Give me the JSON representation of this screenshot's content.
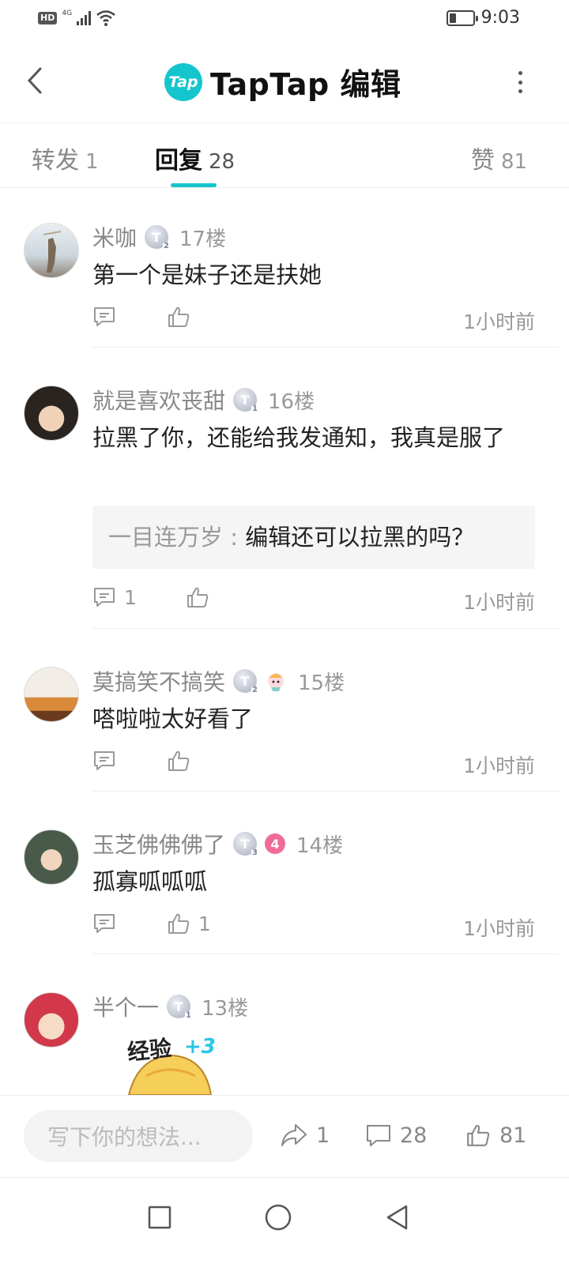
{
  "status_bar": {
    "hd": "HD",
    "network": "4G",
    "time": "9:03",
    "icons": [
      "hd-icon",
      "signal-icon",
      "wifi-icon",
      "battery-icon"
    ]
  },
  "header": {
    "logo_text": "Tap",
    "title": "TapTap 编辑",
    "accent_color": "#15c5ce"
  },
  "tabs": [
    {
      "label": "转发",
      "count": "1"
    },
    {
      "label": "回复",
      "count": "28",
      "active": true
    },
    {
      "label": "赞",
      "count": "81"
    }
  ],
  "comments": [
    {
      "name": "米咖",
      "level": "2",
      "floor": "17楼",
      "text": "第一个是妹子还是扶她",
      "reply_count": "",
      "like_count": "",
      "time": "1小时前"
    },
    {
      "name": "就是喜欢丧甜",
      "level": "1",
      "floor": "16楼",
      "text": "拉黑了你，还能给我发通知，我真是服了",
      "quote_user": "一目连万岁 :",
      "quote_text": "编辑还可以拉黑的吗？",
      "reply_count": "1",
      "like_count": "",
      "time": "1小时前"
    },
    {
      "name": "莫搞笑不搞笑",
      "level": "2",
      "floor": "15楼",
      "text": "嗒啦啦太好看了",
      "reply_count": "",
      "like_count": "",
      "time": "1小时前"
    },
    {
      "name": "玉芝佛佛佛了",
      "level": "3",
      "badge": "4",
      "floor": "14楼",
      "text": "孤寡呱呱呱",
      "reply_count": "",
      "like_count": "1",
      "time": "1小时前"
    },
    {
      "name": "半个一",
      "level": "1",
      "floor": "13楼",
      "sticker_text": "经验",
      "sticker_plus": "+3"
    }
  ],
  "input": {
    "placeholder": "写下你的想法..."
  },
  "bottom_actions": {
    "share_count": "1",
    "comment_count": "28",
    "like_count": "81"
  }
}
